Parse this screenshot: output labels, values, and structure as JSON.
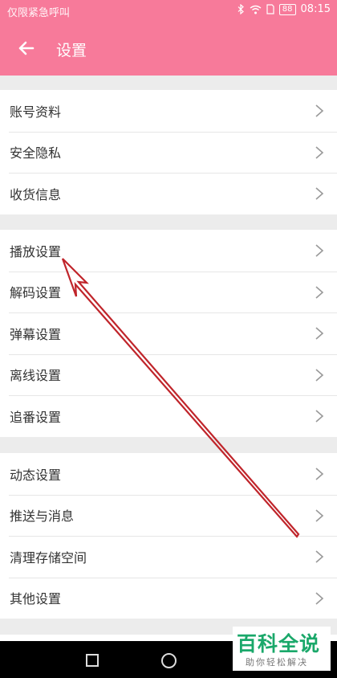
{
  "status_bar": {
    "carrier_text": "仅限紧急呼叫",
    "battery": "88",
    "time": "08:15",
    "icons": [
      "bluetooth-icon",
      "wifi-icon",
      "sim-icon",
      "battery-icon"
    ]
  },
  "app_bar": {
    "back_icon": "arrow-left-icon",
    "title": "设置"
  },
  "groups": [
    {
      "items": [
        "账号资料",
        "安全隐私",
        "收货信息"
      ]
    },
    {
      "items": [
        "播放设置",
        "解码设置",
        "弹幕设置",
        "离线设置",
        "追番设置"
      ]
    },
    {
      "items": [
        "动态设置",
        "推送与消息",
        "清理存储空间",
        "其他设置"
      ]
    }
  ],
  "colors": {
    "header": "#f77a9a",
    "background": "#ececec",
    "annotation_arrow": "#c0252b",
    "watermark_green": "#1aa86a"
  },
  "nav_bar": {
    "icons": [
      "recent-apps-icon",
      "home-icon"
    ]
  },
  "watermark": {
    "brand": "百科全说",
    "slogan": "助你轻松解决"
  }
}
